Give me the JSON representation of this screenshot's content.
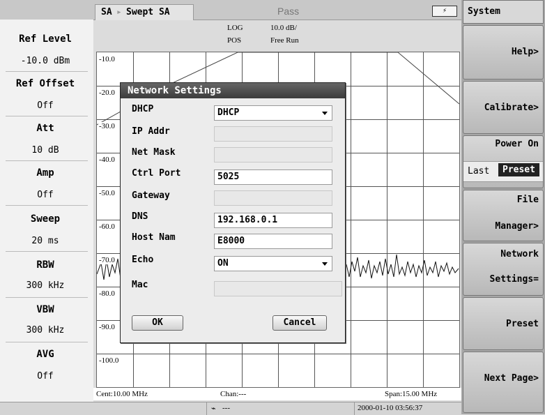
{
  "top_bar": {
    "mode": "SA",
    "sub_mode": "Swept SA",
    "status": "Pass",
    "battery_icon": "battery-charging-icon"
  },
  "left_panel": [
    {
      "label": "Ref Level",
      "value": "-10.0 dBm"
    },
    {
      "label": "Ref Offset",
      "value": "Off"
    },
    {
      "label": "Att",
      "value": "10 dB"
    },
    {
      "label": "Amp",
      "value": "Off"
    },
    {
      "label": "Sweep",
      "value": "20 ms"
    },
    {
      "label": "RBW",
      "value": "300 kHz"
    },
    {
      "label": "VBW",
      "value": "300 kHz"
    },
    {
      "label": "AVG",
      "value": "Off"
    }
  ],
  "trace_header": {
    "scale_type": "LOG",
    "scale": "10.0 dB/",
    "detector": "POS",
    "trigger": "Free Run"
  },
  "y_axis_labels": [
    "-10.0",
    "-20.0",
    "-30.0",
    "-40.0",
    "-50.0",
    "-60.0",
    "-70.0",
    "-80.0",
    "-90.0",
    "-100.0"
  ],
  "bottom_info": {
    "center": "Cent:10.00 MHz",
    "channel": "Chan:---",
    "span": "Span:15.00 MHz"
  },
  "status_bar": {
    "icon": "network-icon",
    "conn": "---",
    "datetime": "2000-01-10 03:56:37"
  },
  "softkeys": {
    "title": "System",
    "help": "Help>",
    "calibrate": "Calibrate>",
    "power_on": "Power On",
    "power_last": "Last",
    "power_preset": "Preset",
    "file": "File",
    "manager": "Manager>",
    "network": "Network",
    "settings": "Settings=",
    "preset": "Preset",
    "next_page": "Next Page>"
  },
  "dialog": {
    "title": "Network Settings",
    "fields": {
      "dhcp": {
        "label": "DHCP",
        "value": "DHCP"
      },
      "ip_addr": {
        "label": "IP Addr",
        "value": ""
      },
      "net_mask": {
        "label": "Net Mask",
        "value": ""
      },
      "ctrl_port": {
        "label": "Ctrl Port",
        "value": "5025"
      },
      "gateway": {
        "label": "Gateway",
        "value": ""
      },
      "dns": {
        "label": "DNS",
        "value": "192.168.0.1"
      },
      "host_name": {
        "label": "Host Nam",
        "value": "E8000"
      },
      "echo": {
        "label": "Echo",
        "value": "ON"
      },
      "mac": {
        "label": "Mac",
        "value": ""
      }
    },
    "ok_label": "OK",
    "cancel_label": "Cancel"
  }
}
